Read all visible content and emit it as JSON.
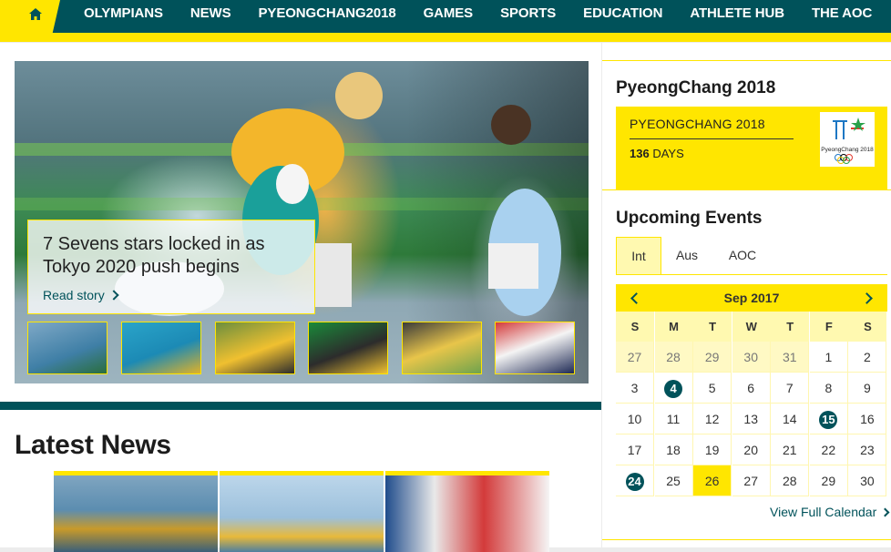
{
  "nav": {
    "home_icon": "home-icon",
    "items": [
      "OLYMPIANS",
      "NEWS",
      "PYEONGCHANG2018",
      "GAMES",
      "SPORTS",
      "EDUCATION",
      "ATHLETE HUB",
      "THE AOC"
    ]
  },
  "hero": {
    "title": "7 Sevens stars locked in as Tokyo 2020 push begins",
    "read_story": "Read story"
  },
  "latest": {
    "title": "Latest News"
  },
  "pyeongchang": {
    "heading": "PyeongChang 2018",
    "box_title": "PYEONGCHANG 2018",
    "days_count": "136",
    "days_label": "DAYS",
    "logo_text": "PyeongChang 2018"
  },
  "events": {
    "heading": "Upcoming Events",
    "tabs": [
      "Int",
      "Aus",
      "AOC"
    ],
    "active_tab": "Int"
  },
  "calendar": {
    "month": "Sep 2017",
    "weekdays": [
      "S",
      "M",
      "T",
      "W",
      "T",
      "F",
      "S"
    ],
    "weeks": [
      [
        "27",
        "28",
        "29",
        "30",
        "31",
        "1",
        "2"
      ],
      [
        "3",
        "4",
        "5",
        "6",
        "7",
        "8",
        "9"
      ],
      [
        "10",
        "11",
        "12",
        "13",
        "14",
        "15",
        "16"
      ],
      [
        "17",
        "18",
        "19",
        "20",
        "21",
        "22",
        "23"
      ],
      [
        "24",
        "25",
        "26",
        "27",
        "28",
        "29",
        "30"
      ]
    ],
    "muted_days": [
      "27",
      "28",
      "29",
      "30",
      "31"
    ],
    "event_days": [
      "4",
      "15",
      "24"
    ],
    "today": "26",
    "full_calendar": "View Full Calendar"
  },
  "colors": {
    "teal": "#00525a",
    "yellow": "#ffe600",
    "light_yellow": "#fff9b0"
  }
}
